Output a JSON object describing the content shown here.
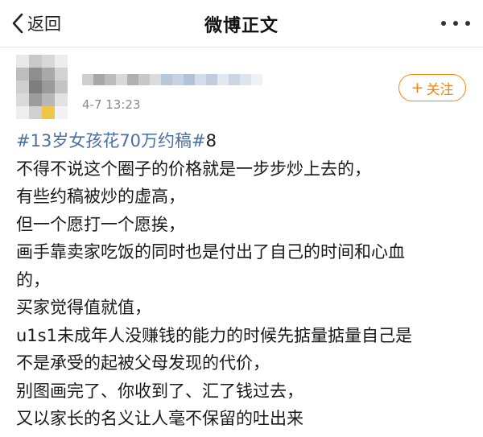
{
  "navbar": {
    "back_label": "返回",
    "title": "微博正文"
  },
  "post": {
    "time": "4-7 13:23",
    "follow_label": "关注",
    "hashtag": "#13岁女孩花70万约稿#",
    "hashtag_suffix": "8",
    "lines": [
      "不得不说这个圈子的价格就是一步步炒上去的，",
      "有些约稿被炒的虚高，",
      "但一个愿打一个愿挨，",
      "画手靠卖家吃饭的同时也是付出了自己的时间和心血",
      "的，",
      "买家觉得值就值，",
      "u1s1未成年人没赚钱的能力的时候先掂量掂量自己是",
      "不是承受的起被父母发现的代价，",
      "别图画完了、你收到了、汇了钱过去，",
      "又以家长的名义让人毫不保留的吐出来"
    ]
  },
  "colors": {
    "accent_orange": "#ff8200",
    "hashtag_blue": "#4a6fa5",
    "meta_gray": "#8a8a8a"
  },
  "icons": [
    "chevron-left-icon",
    "more-dots-icon",
    "plus-icon"
  ]
}
